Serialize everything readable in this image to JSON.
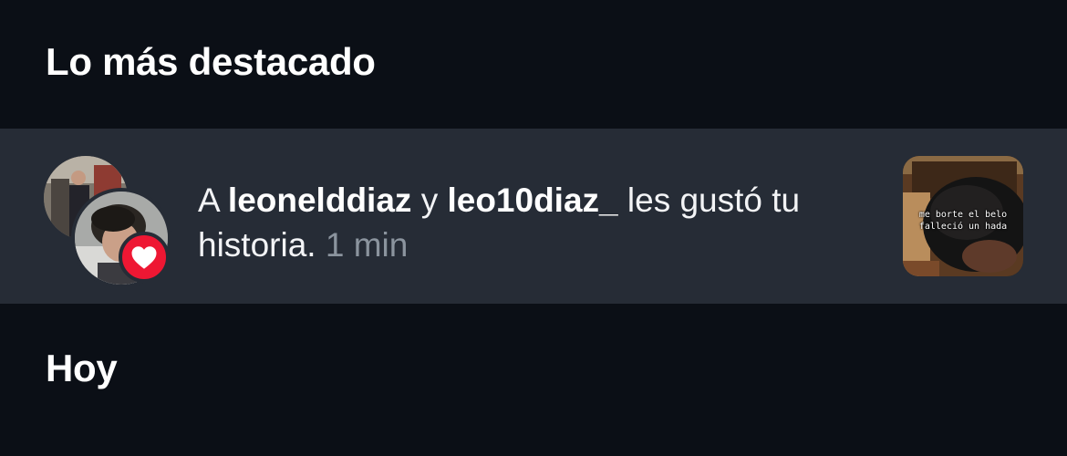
{
  "sections": {
    "highlights_title": "Lo más destacado",
    "today_title": "Hoy"
  },
  "notification": {
    "prefix": "A",
    "user1": "leonelddiaz",
    "connector": "y",
    "user2": "leo10diaz_",
    "action": "les gustó tu historia.",
    "time": "1 min",
    "badge_icon": "heart-icon",
    "badge_color": "#ee1733",
    "story_caption_line1": "me borte el belo",
    "story_caption_line2": "falleció un hada"
  },
  "colors": {
    "background": "#0b0f16",
    "row_background": "#262c36",
    "secondary_text": "#8b949e"
  }
}
